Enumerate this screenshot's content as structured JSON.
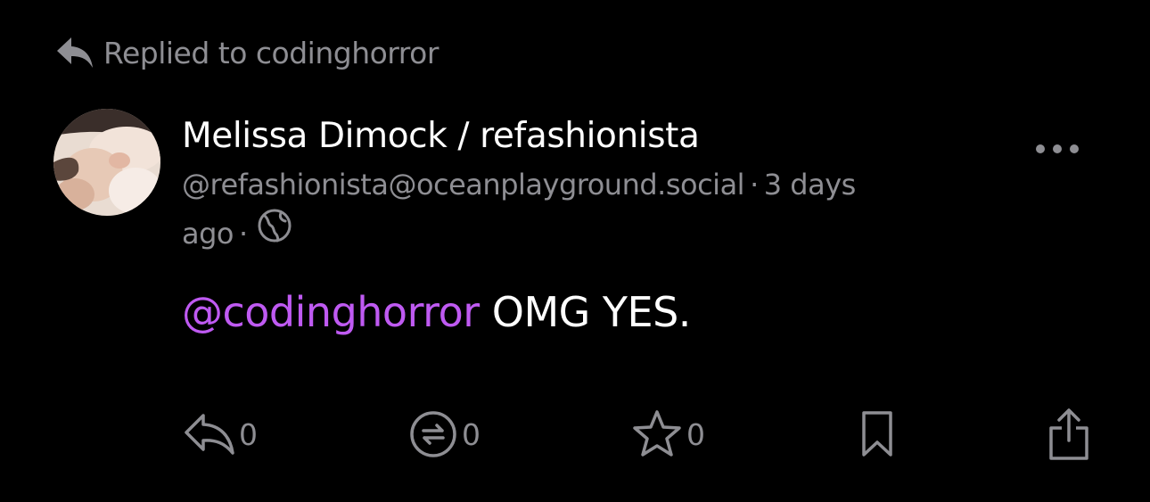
{
  "reply_context": {
    "text": "Replied to codinghorror",
    "icon": "reply-arrow-filled-icon"
  },
  "post": {
    "author": {
      "display_name": "Melissa Dimock / refashionista",
      "handle": "@refashionista@oceanplayground.social",
      "avatar": "avatar-photo"
    },
    "separator": "·",
    "timestamp": "3 days ago",
    "visibility_icon": "globe-icon",
    "content": {
      "mention": "@codinghorror",
      "text": " OMG YES."
    }
  },
  "actions": {
    "reply_count": "0",
    "boost_count": "0",
    "favourite_count": "0"
  },
  "colors": {
    "background": "#000000",
    "primary_text": "#ffffff",
    "secondary_text": "#8e8e93",
    "mention": "#bf5af2"
  }
}
